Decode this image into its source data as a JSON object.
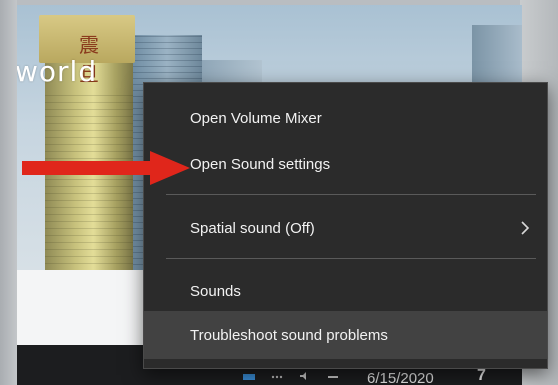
{
  "wallpaper": {
    "overlay_text": "world",
    "sign_text": "震旦"
  },
  "context_menu": {
    "items": [
      {
        "label": "Open Volume Mixer"
      },
      {
        "label": "Open Sound settings"
      },
      {
        "label": "Spatial sound (Off)",
        "submenu": true
      },
      {
        "label": "Sounds"
      },
      {
        "label": "Troubleshoot sound problems",
        "highlighted": true
      }
    ]
  },
  "taskbar": {
    "clock_date": "6/15/2020",
    "notification_count": "7"
  },
  "annotation": {
    "arrow_color": "#e0261b",
    "points_to": "Open Sound settings"
  },
  "icons": {
    "chevron": "chevron-right-icon",
    "arrow": "red-arrow-icon"
  }
}
